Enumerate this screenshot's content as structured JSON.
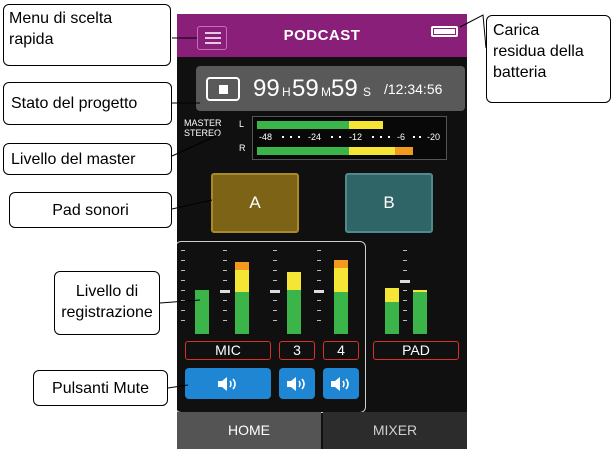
{
  "app": {
    "title": "PODCAST"
  },
  "status": {
    "hours": "99",
    "hours_unit": "H",
    "minutes": "59",
    "minutes_unit": "M",
    "seconds": "59",
    "seconds_unit": "S",
    "total": "/12:34:56"
  },
  "master_meter": {
    "label_line1": "MASTER",
    "label_line2": "STEREO",
    "left_channel": "L",
    "right_channel": "R",
    "scale": [
      "-48",
      "-24",
      "-12",
      "-6",
      "-20"
    ],
    "left_level": 0.69,
    "right_level": 0.83
  },
  "pads": {
    "a_label": "A",
    "b_label": "B",
    "a_color": "#7c6316",
    "b_color": "#2f6566"
  },
  "channels": {
    "mic_label": "MIC",
    "ch3_label": "3",
    "ch4_label": "4",
    "pad_label": "PAD"
  },
  "tabs": {
    "home": "HOME",
    "mixer": "MIXER"
  },
  "callouts": {
    "quick_menu_line1": "Menu di scelta",
    "quick_menu_line2": "rapida",
    "project_status": "Stato del progetto",
    "master_level": "Livello del master",
    "sound_pads": "Pad sonori",
    "rec_level_line1": "Livello di",
    "rec_level_line2": "registrazione",
    "mute_buttons": "Pulsanti Mute",
    "battery_line1": "Carica",
    "battery_line2": "residua della",
    "battery_line3": "batteria"
  },
  "colors": {
    "accent": "#8a1f7a",
    "meter_green": "#3bb54a",
    "meter_yellow": "#f5e636",
    "meter_orange": "#f39a1e",
    "mute_blue": "#1f86d4",
    "label_red": "#d9302a"
  },
  "icons": {
    "menu": "hamburger-icon",
    "battery": "battery-icon",
    "stop": "stop-icon",
    "mute": "speaker-icon"
  }
}
